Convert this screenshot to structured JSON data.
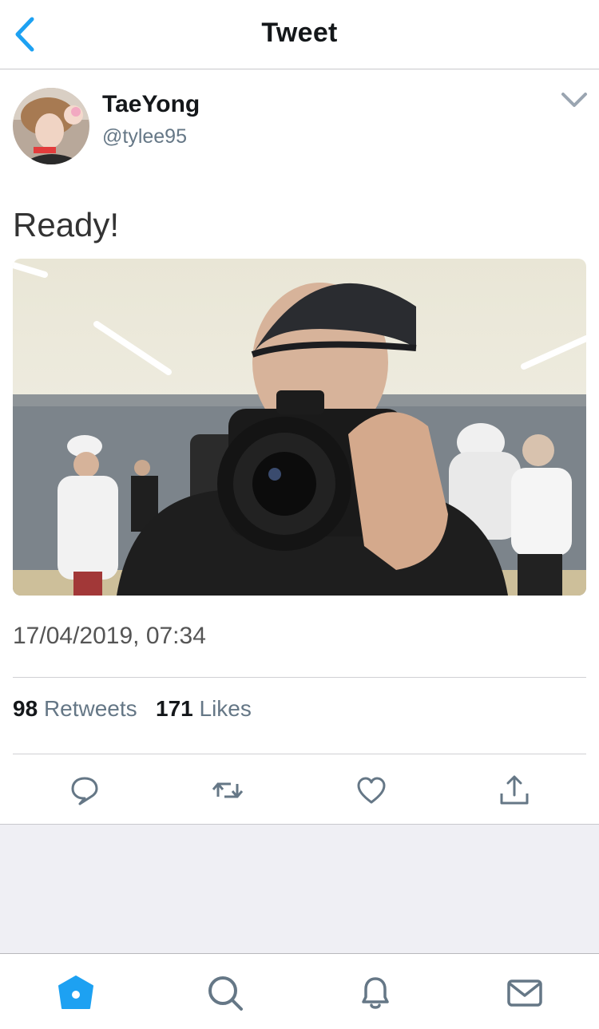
{
  "header": {
    "title": "Tweet"
  },
  "author": {
    "display_name": "TaeYong",
    "handle": "@tylee95"
  },
  "tweet": {
    "text": "Ready!",
    "timestamp": "17/04/2019, 07:34",
    "retweets": "98",
    "retweets_label": "Retweets",
    "likes": "171",
    "likes_label": "Likes"
  },
  "icons": {
    "back": "chevron-left-icon",
    "more": "chevron-down-icon",
    "reply": "reply-icon",
    "retweet": "retweet-icon",
    "like": "heart-icon",
    "share": "share-icon",
    "home": "home-icon",
    "search": "search-icon",
    "notifications": "bell-icon",
    "messages": "mail-icon"
  },
  "colors": {
    "accent": "#1da1f2",
    "secondary_text": "#657786",
    "background_gray": "#efeff4"
  }
}
